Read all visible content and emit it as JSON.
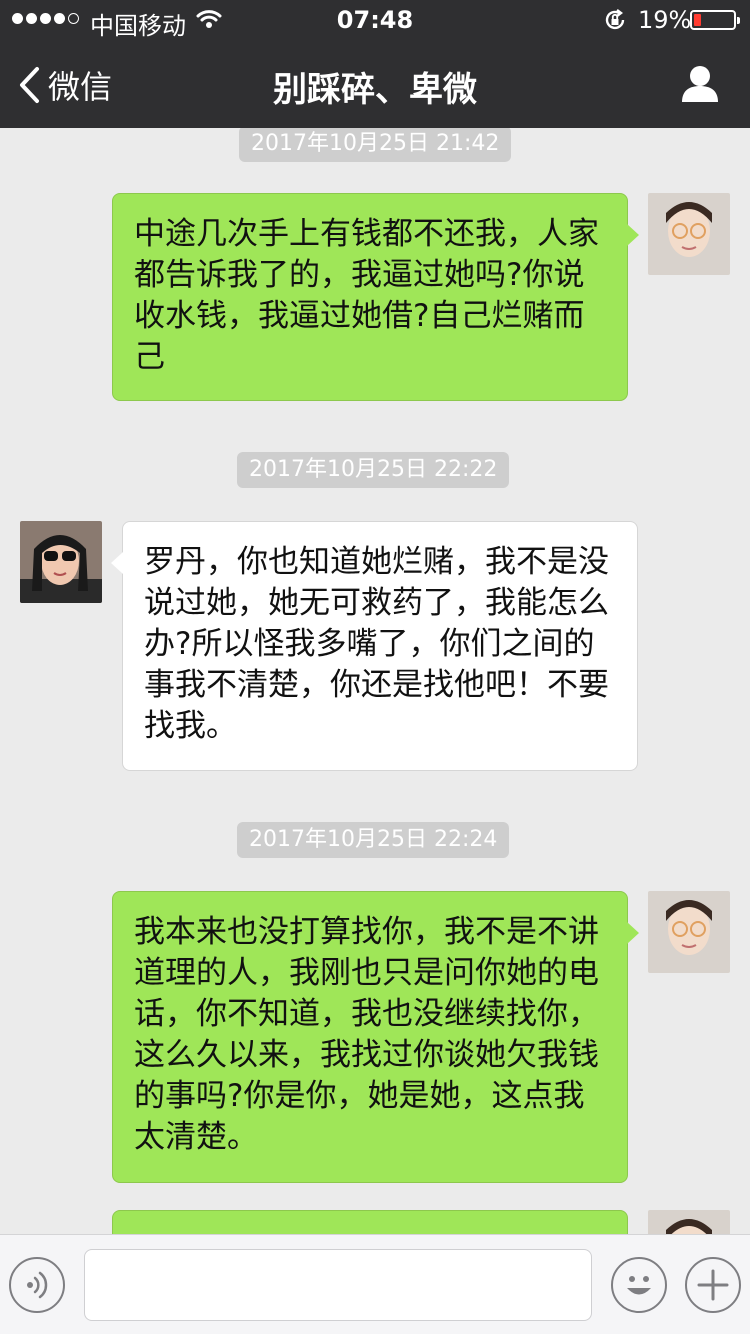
{
  "status_bar": {
    "carrier": "中国移动",
    "time": "07:48",
    "battery_percent": "19%",
    "battery_level": 0.19,
    "signal_bars_filled": 4,
    "signal_bars_total": 5
  },
  "nav": {
    "back_label": "微信",
    "title": "别踩碎、卑微",
    "back_icon": "chevron-left-icon",
    "profile_icon": "person-icon"
  },
  "messages": [
    {
      "type": "timestamp",
      "text": "2017年10月25日 21:42"
    },
    {
      "type": "bubble",
      "sender": "me",
      "text": "中途几次手上有钱都不还我，人家都告诉我了的，我逼过她吗?你说收水钱，我逼过她借?自己烂赌而己"
    },
    {
      "type": "timestamp",
      "text": "2017年10月25日 22:22"
    },
    {
      "type": "bubble",
      "sender": "them",
      "text": "罗丹，你也知道她烂赌，我不是没说过她，她无可救药了，我能怎么办?所以怪我多嘴了，你们之间的事我不清楚，你还是找他吧！不要找我。"
    },
    {
      "type": "timestamp",
      "text": "2017年10月25日 22:24"
    },
    {
      "type": "bubble",
      "sender": "me",
      "text": "我本来也没打算找你，我不是不讲道理的人，我刚也只是问你她的电话，你不知道，我也没继续找你，这么久以来，我找过你谈她欠我钱的事吗?你是你，她是她，这点我太清楚。"
    }
  ],
  "input_bar": {
    "voice_icon": "voice-icon",
    "emoji_icon": "emoji-icon",
    "more_icon": "plus-icon",
    "text_value": ""
  },
  "colors": {
    "nav_bg": "#2f2f31",
    "chat_bg": "#ebebeb",
    "my_bubble": "#9fe658",
    "their_bubble": "#ffffff",
    "timestamp_bg": "#cecece",
    "battery_low": "#ff3b30"
  }
}
